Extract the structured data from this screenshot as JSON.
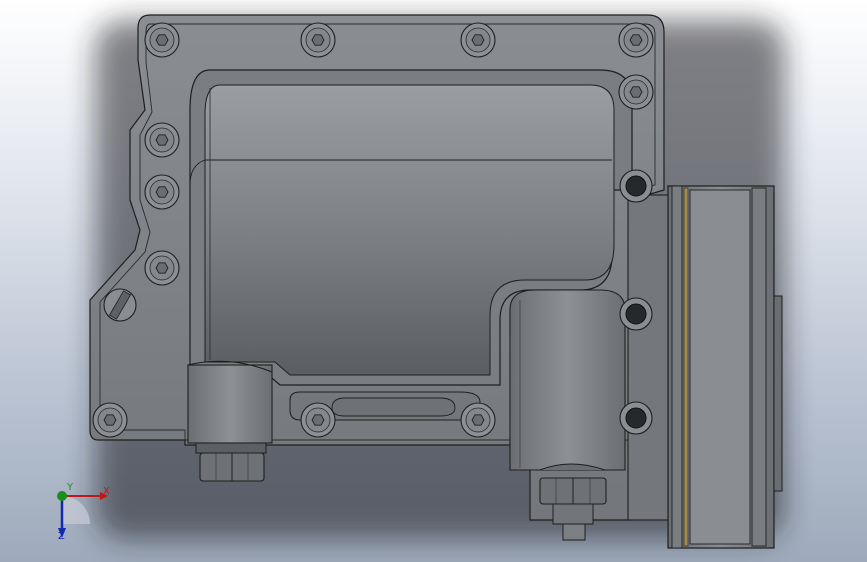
{
  "viewport": {
    "background_top": "#ffffff",
    "background_bottom": "#9eaabb",
    "part_color": "#7e8286",
    "edge_color": "#1e1e1e"
  },
  "triad": {
    "x_label": "X",
    "y_label": "Y",
    "z_label": "Z",
    "x_color": "#c01818",
    "y_color": "#1a8f1a",
    "z_color": "#1428b0"
  }
}
